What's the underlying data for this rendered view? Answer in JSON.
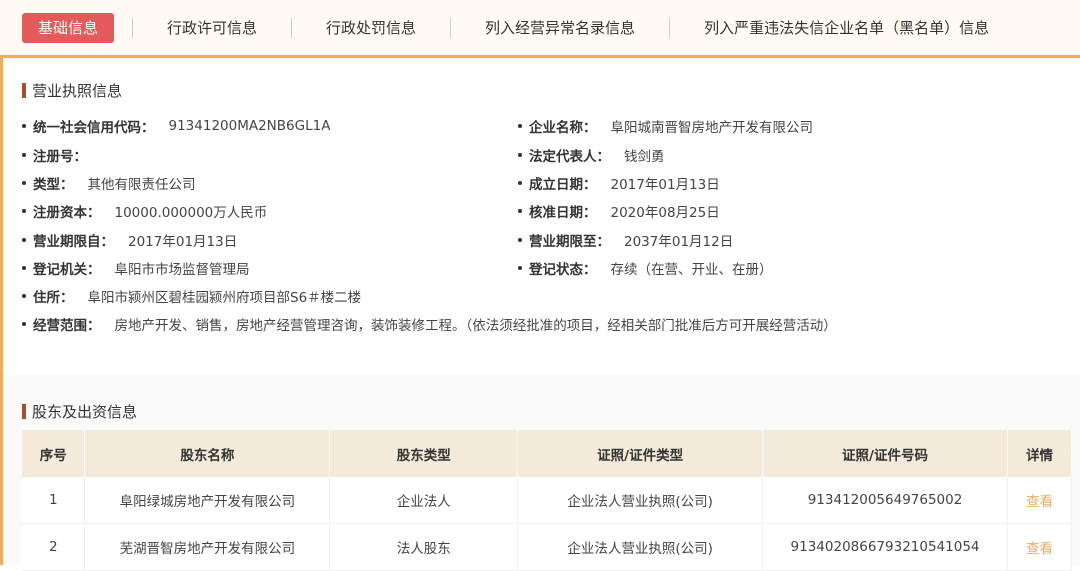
{
  "tabs": [
    "基础信息",
    "行政许可信息",
    "行政处罚信息",
    "列入经营异常名录信息",
    "列入严重违法失信企业名单（黑名单）信息"
  ],
  "license": {
    "title": "营业执照信息",
    "credit_code_label": "统一社会信用代码：",
    "credit_code": "91341200MA2NB6GL1A",
    "name_label": "企业名称：",
    "name": "阜阳城南晋智房地产开发有限公司",
    "reg_no_label": "注册号：",
    "reg_no": "",
    "legal_rep_label": "法定代表人：",
    "legal_rep": "钱剑勇",
    "type_label": "类型：",
    "type": "其他有限责任公司",
    "est_date_label": "成立日期：",
    "est_date": "2017年01月13日",
    "capital_label": "注册资本：",
    "capital": "10000.000000万人民币",
    "approve_date_label": "核准日期：",
    "approve_date": "2020年08月25日",
    "term_from_label": "营业期限自：",
    "term_from": "2017年01月13日",
    "term_to_label": "营业期限至：",
    "term_to": "2037年01月12日",
    "authority_label": "登记机关：",
    "authority": "阜阳市市场监督管理局",
    "status_label": "登记状态：",
    "status": "存续（在营、开业、在册）",
    "address_label": "住所：",
    "address": "阜阳市颍州区碧桂园颍州府项目部S6＃楼二楼",
    "scope_label": "经营范围：",
    "scope": "房地产开发、销售，房地产经营管理咨询，装饰装修工程。（依法须经批准的项目，经相关部门批准后方可开展经营活动）"
  },
  "shareholders": {
    "title": "股东及出资信息",
    "headers": [
      "序号",
      "股东名称",
      "股东类型",
      "证照/证件类型",
      "证照/证件号码",
      "详情"
    ],
    "rows": [
      [
        "1",
        "阜阳绿城房地产开发有限公司",
        "企业法人",
        "企业法人营业执照(公司)",
        "913412005649765002",
        "查看"
      ],
      [
        "2",
        "芜湖晋智房地产开发有限公司",
        "法人股东",
        "企业法人营业执照(公司)",
        "91340208667932105410​54",
        "查看"
      ]
    ]
  }
}
